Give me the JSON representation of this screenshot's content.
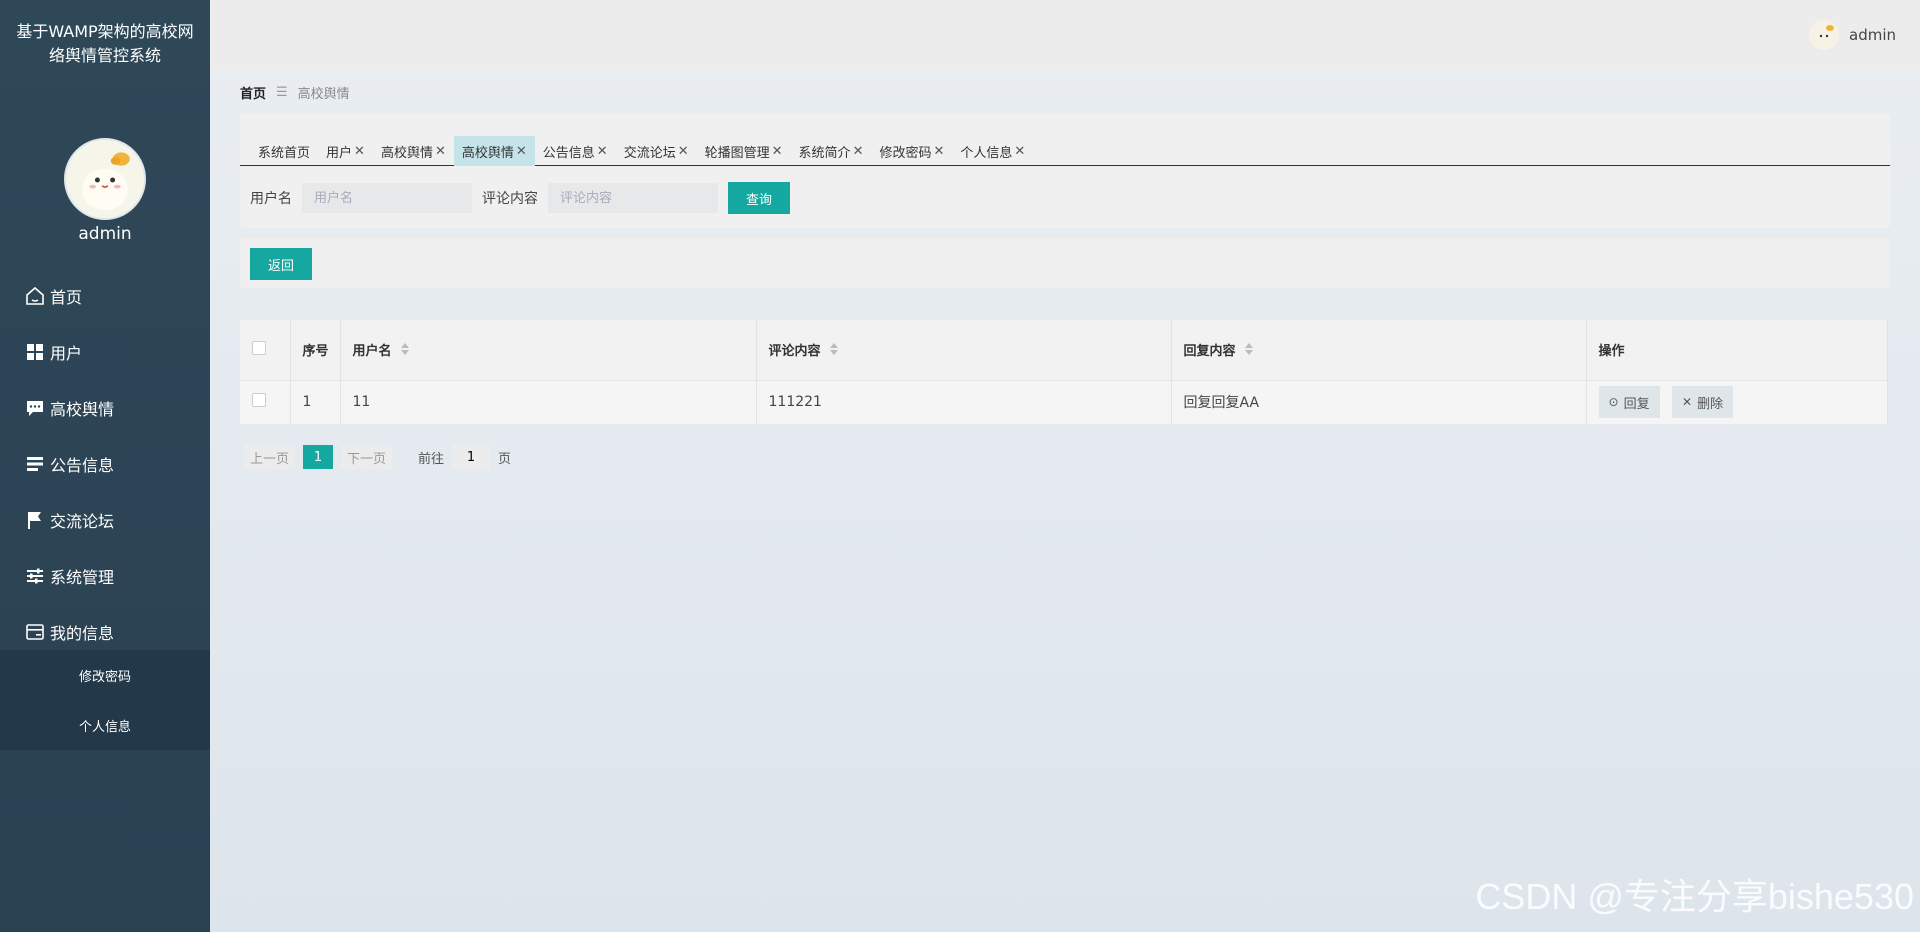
{
  "sidebar": {
    "title": "基于WAMP架构的高校网络舆情管控系统",
    "username": "admin",
    "nav": [
      {
        "label": "首页",
        "icon": "home-icon"
      },
      {
        "label": "用户",
        "icon": "grid-icon"
      },
      {
        "label": "高校舆情",
        "icon": "chat-icon"
      },
      {
        "label": "公告信息",
        "icon": "list-icon"
      },
      {
        "label": "交流论坛",
        "icon": "flag-icon"
      },
      {
        "label": "系统管理",
        "icon": "sliders-icon"
      },
      {
        "label": "我的信息",
        "icon": "card-icon"
      }
    ],
    "submenu": [
      {
        "label": "修改密码"
      },
      {
        "label": "个人信息"
      }
    ]
  },
  "header": {
    "username": "admin"
  },
  "breadcrumb": {
    "home": "首页",
    "separator": "☰",
    "current": "高校舆情"
  },
  "tabs": [
    {
      "label": "系统首页",
      "closable": false
    },
    {
      "label": "用户",
      "closable": true
    },
    {
      "label": "高校舆情",
      "closable": true
    },
    {
      "label": "高校舆情",
      "closable": true,
      "active": true
    },
    {
      "label": "公告信息",
      "closable": true
    },
    {
      "label": "交流论坛",
      "closable": true
    },
    {
      "label": "轮播图管理",
      "closable": true
    },
    {
      "label": "系统简介",
      "closable": true
    },
    {
      "label": "修改密码",
      "closable": true
    },
    {
      "label": "个人信息",
      "closable": true
    }
  ],
  "search": {
    "username_label": "用户名",
    "username_placeholder": "用户名",
    "content_label": "评论内容",
    "content_placeholder": "评论内容",
    "query_button": "查询"
  },
  "back_button": "返回",
  "table": {
    "columns": {
      "index": "序号",
      "username": "用户名",
      "content": "评论内容",
      "reply": "回复内容",
      "ops": "操作"
    },
    "rows": [
      {
        "index": "1",
        "username": "11",
        "content": "111221",
        "reply": "回复回复AA"
      }
    ],
    "reply_button": "回复",
    "delete_button": "删除"
  },
  "pager": {
    "prev": "上一页",
    "current": "1",
    "next": "下一页",
    "goto": "前往",
    "goto_value": "1",
    "page_suffix": "页"
  },
  "watermark": "CSDN @专注分享bishe530",
  "colors": {
    "sidebar": "#2f4858",
    "accent": "#15a8a0",
    "active_tab": "#c4e4ea"
  }
}
